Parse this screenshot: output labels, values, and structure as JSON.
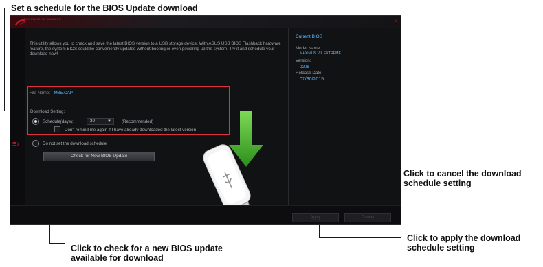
{
  "callouts": {
    "schedule": "Set a schedule for the BIOS Update download",
    "cancel_line1": "Click to cancel the download",
    "cancel_line2": "schedule setting",
    "apply_line1": "Click to apply the download",
    "apply_line2": "schedule setting",
    "check_line1": "Click to check for a new BIOS update",
    "check_line2": "available for download"
  },
  "app": {
    "brand": "REPUBLIC OF GAMERS",
    "close": "×",
    "description": "This utility allows you to check and save the latest BIOS version to a USB storage device. With ASUS USB BIOS Flashback hardware feature, the system BIOS could be conveniently updated without booting or even powering up the system. Try it and schedule your download now!",
    "file_name_label": "File Name:",
    "file_name_value": "M8E.CAP",
    "download_setting_label": "Download Setting:",
    "schedule_label": "Schedule(days):",
    "days_value": "30",
    "recommended": "(Recommended)",
    "dont_remind": "Don't remind me again if I have already downloaded the latest version",
    "no_schedule": "Do not set the download schedule",
    "check_button": "Check for New BIOS Update",
    "apply_button": "Apply",
    "cancel_button": "Cancel"
  },
  "current_bios": {
    "heading": "Current BIOS",
    "model_label": "Model Name:",
    "model_value": "MAXIMUS VIII EXTREME",
    "version_label": "Version:",
    "version_value": "0208",
    "date_label": "Release Date:",
    "date_value": "07/30/2015"
  },
  "colors": {
    "accent_red": "#e0323c",
    "value_blue": "#5fb8ff",
    "usb_green": "#3fb52a"
  },
  "icons": [
    "rog-logo-icon",
    "close-icon",
    "sidebar-expand-icon",
    "usb-drive-icon",
    "download-arrow-icon",
    "dropdown-caret-icon"
  ]
}
